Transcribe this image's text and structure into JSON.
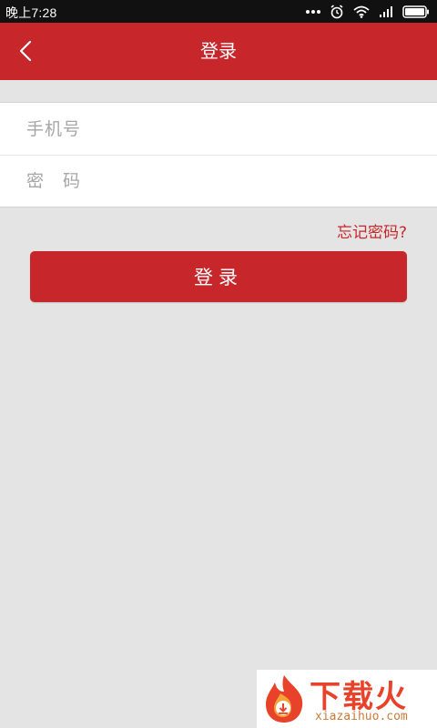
{
  "status_bar": {
    "time": "晚上7:28"
  },
  "header": {
    "title": "登录",
    "back_icon": "chevron-left-icon"
  },
  "form": {
    "phone_placeholder": "手机号",
    "password_placeholder": "密　码"
  },
  "forgot_password_label": "忘记密码?",
  "login_button_label": "登录",
  "watermark": {
    "brand": "下载火",
    "url": "xiazaihuo.com"
  },
  "colors": {
    "brand_red": "#c7262b",
    "background": "#e3e4e3"
  }
}
